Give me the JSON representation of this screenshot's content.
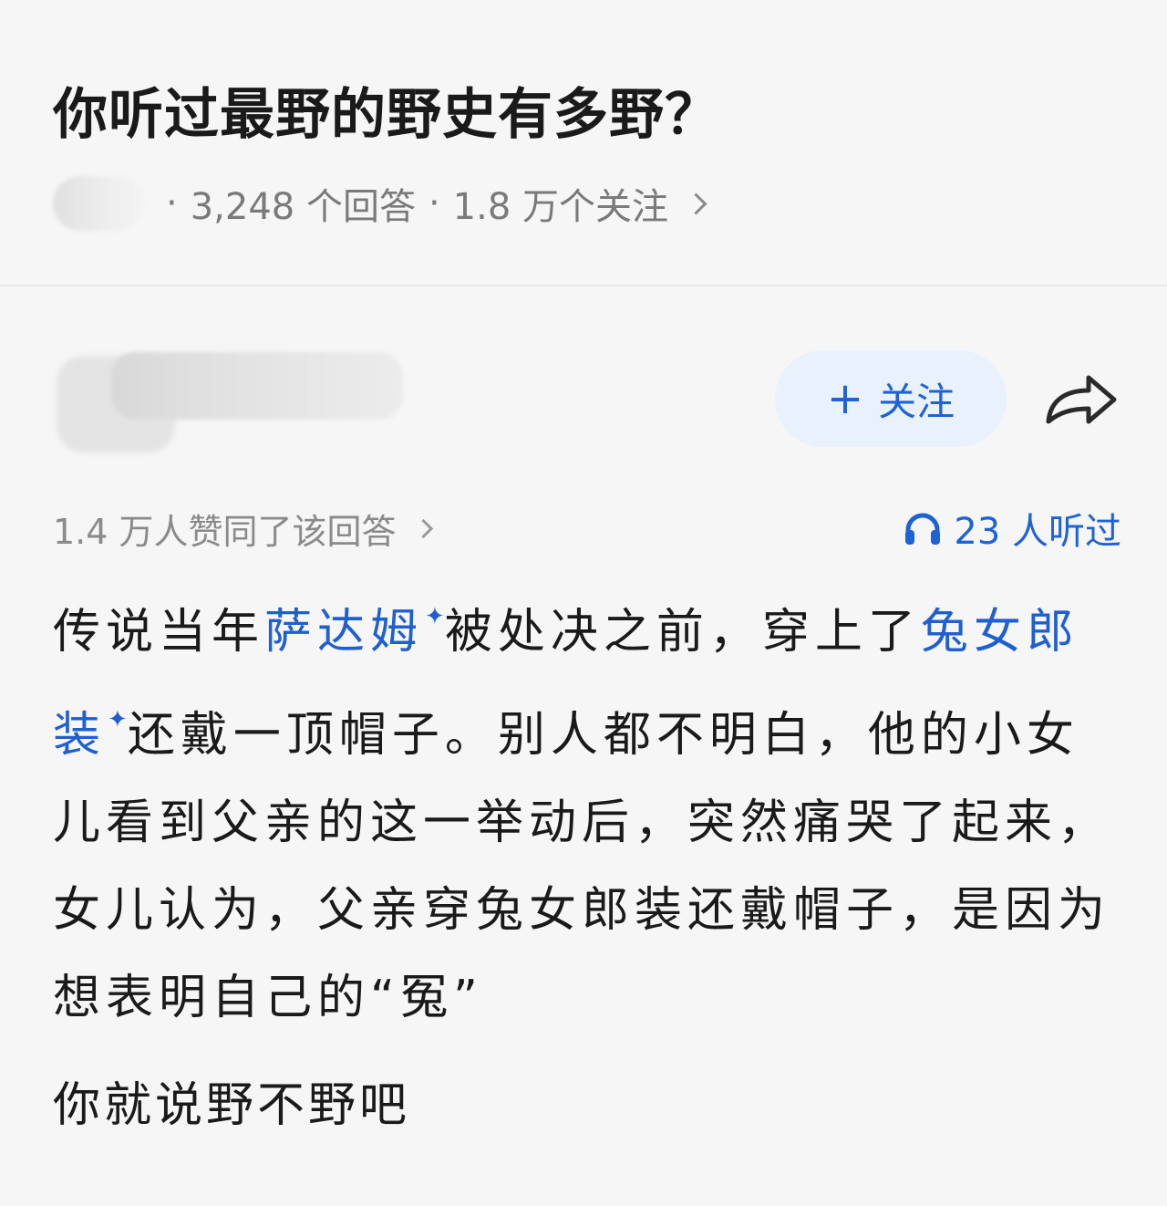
{
  "question": {
    "title": "你听过最野的野史有多野？",
    "answers_count": "3,248 个回答",
    "followers_count": "1.8 万个关注",
    "separator": "·"
  },
  "author": {
    "follow_label": "关注",
    "follow_icon": "plus-icon",
    "share_icon": "share-arrow-icon"
  },
  "stats": {
    "approvals": "1.4 万人赞同了该回答",
    "listens": "23 人听过",
    "listen_icon": "headphones-icon"
  },
  "answer": {
    "seg1": "传说当年",
    "link1": "萨达姆",
    "seg2": "被处决之前，穿上了",
    "link2": "兔女郎装",
    "seg3": "还戴一顶帽子。别人都不明白，他的小女儿看到父亲的这一举动后，突然痛哭了起来，女儿认为，父亲穿兔女郎装还戴帽子，是因为想表明自己的“冤”",
    "footer": "你就说野不野吧"
  },
  "colors": {
    "accent": "#1e63d6",
    "follow_bg": "#e9f1fc",
    "meta_gray": "#7a7a7a",
    "background": "#f6f6f6"
  }
}
